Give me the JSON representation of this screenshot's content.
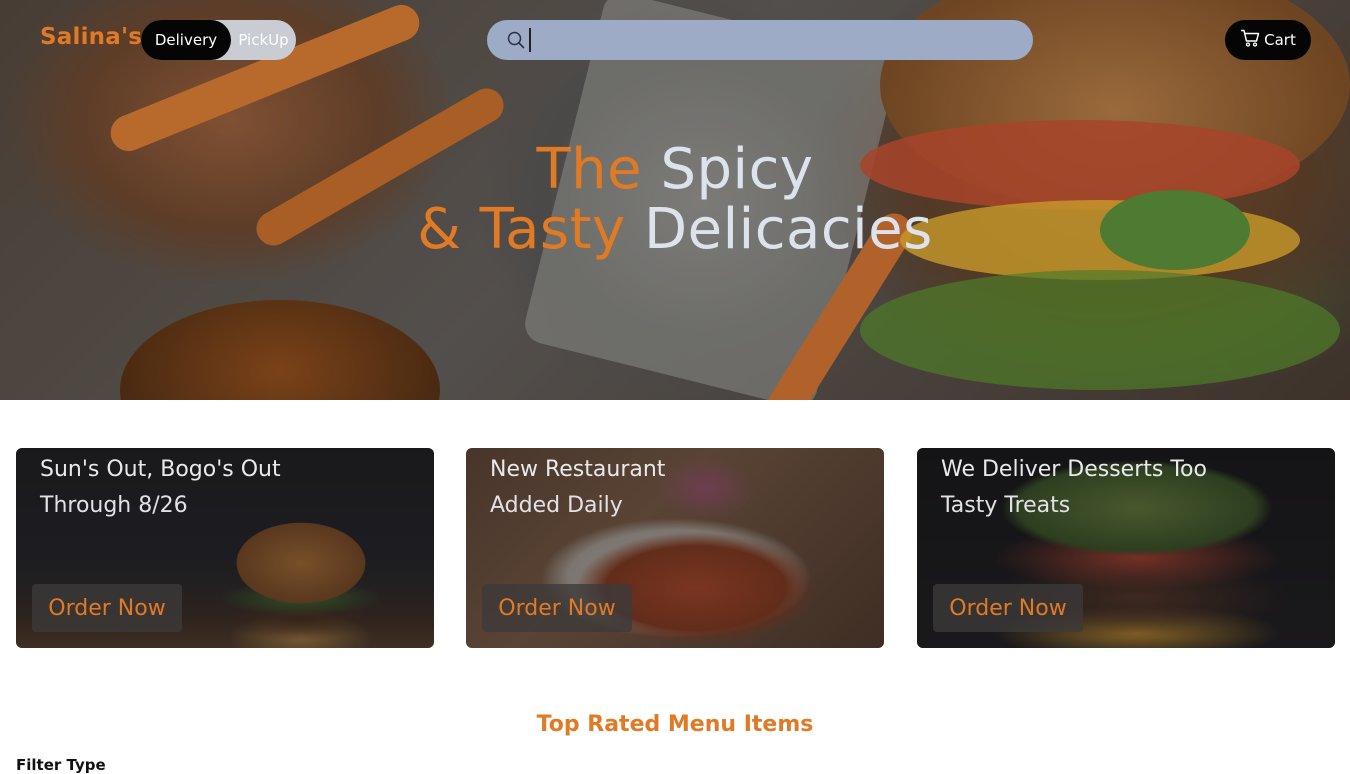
{
  "header": {
    "brand": "Salina's",
    "order_mode": {
      "options": [
        "Delivery",
        "PickUp"
      ],
      "selected": "Delivery"
    },
    "search": {
      "value": "",
      "placeholder": ""
    },
    "cart_label": "Cart"
  },
  "hero": {
    "line1": {
      "orange": "The",
      "light": "Spicy"
    },
    "line2": {
      "orange": "& Tasty",
      "light": "Delicacies"
    }
  },
  "promos": [
    {
      "title": "Sun's Out, Bogo's Out",
      "subtitle": "Through 8/26",
      "cta": "Order Now"
    },
    {
      "title": "New Restaurant",
      "subtitle": "Added Daily",
      "cta": "Order Now"
    },
    {
      "title": "We Deliver Desserts Too",
      "subtitle": "Tasty Treats",
      "cta": "Order Now"
    }
  ],
  "menu_section": {
    "title": "Top Rated Menu Items",
    "filter_label": "Filter Type"
  },
  "colors": {
    "accent": "#e07a24",
    "dark_button": "#050505",
    "search_bg": "#9eabc7"
  }
}
